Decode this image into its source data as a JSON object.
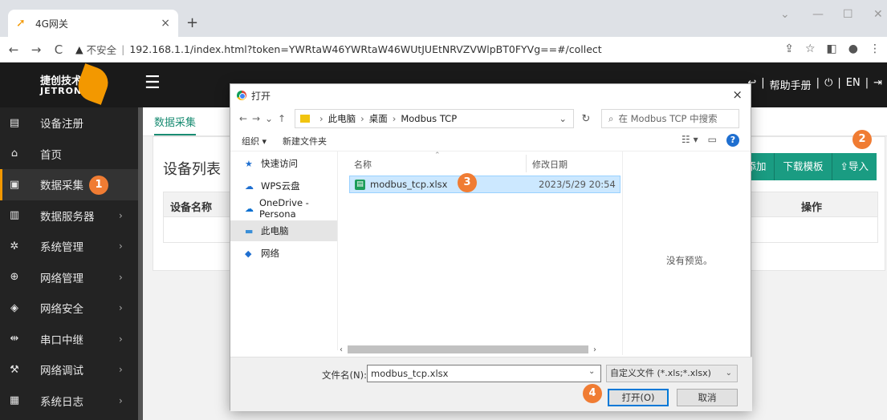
{
  "browser": {
    "tab_title": "4G网关",
    "tab_close": "×",
    "new_tab": "+",
    "back": "←",
    "forward": "→",
    "reload": "C",
    "security_icon": "▲",
    "insecure_label": "不安全",
    "separator": "|",
    "url": "192.168.1.1/index.html?token=YWRtaW46YWRtaW46WUtJUEtNRVZVWlpBT0FYVg==#/collect",
    "win_min": "—",
    "win_max": "☐",
    "win_close": "✕",
    "win_expand": "⌄"
  },
  "header": {
    "logo_cn": "捷创技术",
    "logo_en": "JETRON",
    "links": [
      "帮助手册",
      "EN"
    ]
  },
  "sidebar": {
    "items": [
      {
        "label": "设备注册",
        "icon": "register-icon",
        "arrow": ""
      },
      {
        "label": "首页",
        "icon": "home-icon",
        "arrow": ""
      },
      {
        "label": "数据采集",
        "icon": "data-collect-icon",
        "arrow": ""
      },
      {
        "label": "数据服务器",
        "icon": "server-icon",
        "arrow": "›"
      },
      {
        "label": "系统管理",
        "icon": "gear-icon",
        "arrow": "›"
      },
      {
        "label": "网络管理",
        "icon": "globe-icon",
        "arrow": "›"
      },
      {
        "label": "网络安全",
        "icon": "shield-icon",
        "arrow": "›"
      },
      {
        "label": "串口中继",
        "icon": "usb-icon",
        "arrow": "›"
      },
      {
        "label": "网络调试",
        "icon": "wrench-icon",
        "arrow": "›"
      },
      {
        "label": "系统日志",
        "icon": "log-icon",
        "arrow": "›"
      }
    ]
  },
  "content": {
    "tab": "数据采集",
    "panel_title": "设备列表",
    "buttons": [
      "添加",
      "下载模板",
      "导入"
    ],
    "table_headers": [
      "设备名称",
      "操作"
    ]
  },
  "dialog": {
    "title": "打开",
    "close": "×",
    "breadcrumb": [
      "此电脑",
      "桌面",
      "Modbus TCP"
    ],
    "search_placeholder": "在 Modbus TCP 中搜索",
    "organize": "组织 ▾",
    "new_folder": "新建文件夹",
    "nav_items": [
      {
        "label": "快速访问",
        "icon": "star-icon"
      },
      {
        "label": "WPS云盘",
        "icon": "cloud-icon"
      },
      {
        "label": "OneDrive - Persona",
        "icon": "onedrive-icon"
      },
      {
        "label": "此电脑",
        "icon": "pc-icon"
      },
      {
        "label": "网络",
        "icon": "network-icon"
      }
    ],
    "col_name": "名称",
    "col_date": "修改日期",
    "file": {
      "name": "modbus_tcp.xlsx",
      "date": "2023/5/29 20:54"
    },
    "no_preview": "没有预览。",
    "filename_label": "文件名(N):",
    "filename_value": "modbus_tcp.xlsx",
    "filetype": "自定义文件 (*.xls;*.xlsx)",
    "open_button": "打开(O)",
    "cancel_button": "取消"
  },
  "steps": [
    "1",
    "2",
    "3",
    "4"
  ],
  "colors": {
    "accent": "#f39800",
    "teal": "#1a9c82",
    "step": "#f07c33"
  }
}
